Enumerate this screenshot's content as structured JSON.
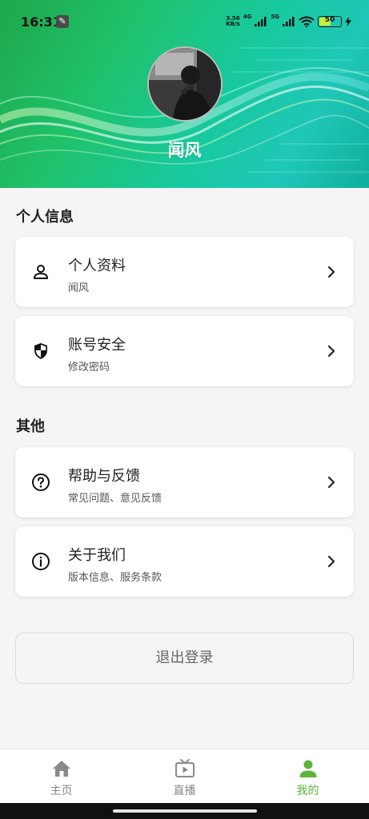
{
  "status_bar": {
    "time": "16:31",
    "net_speed_value": "3.56",
    "net_speed_unit": "KB/s",
    "signal_1_label": "4G",
    "signal_2_label": "5G",
    "battery_level": "50"
  },
  "profile": {
    "username": "闻风"
  },
  "sections": [
    {
      "title": "个人信息",
      "items": [
        {
          "title": "个人资料",
          "subtitle": "闻风",
          "icon": "person-icon"
        },
        {
          "title": "账号安全",
          "subtitle": "修改密码",
          "icon": "shield-icon"
        }
      ]
    },
    {
      "title": "其他",
      "items": [
        {
          "title": "帮助与反馈",
          "subtitle": "常见问题、意见反馈",
          "icon": "help-circle-icon"
        },
        {
          "title": "关于我们",
          "subtitle": "版本信息、服务条款",
          "icon": "info-circle-icon"
        }
      ]
    }
  ],
  "logout_label": "退出登录",
  "bottom_nav": [
    {
      "label": "主页",
      "icon": "home-icon",
      "active": false
    },
    {
      "label": "直播",
      "icon": "tv-play-icon",
      "active": false
    },
    {
      "label": "我的",
      "icon": "person-icon",
      "active": true
    }
  ],
  "colors": {
    "accent": "#5cb43a",
    "header_green": "#1fc26b",
    "header_teal": "#17c9a0"
  }
}
